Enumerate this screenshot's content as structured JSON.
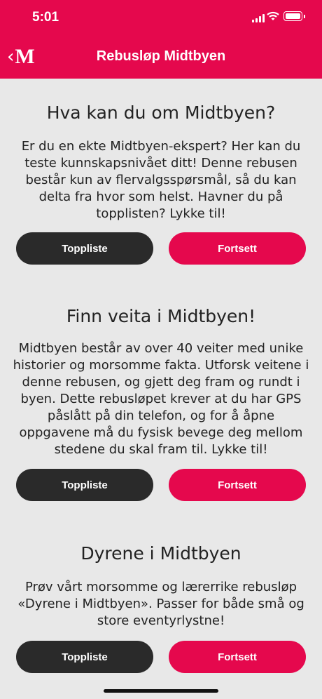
{
  "status_bar": {
    "time": "5:01"
  },
  "nav": {
    "back_logo": "M",
    "title": "Rebusløp Midtbyen"
  },
  "cards": [
    {
      "title": "Hva kan du om Midtbyen?",
      "description": "Er du en ekte Midtbyen-ekspert? Her kan du teste kunnskapsnivået ditt! Denne rebusen består kun av flervalgsspørsmål, så du kan delta fra hvor som helst. Havner du på topplisten? Lykke til!",
      "leaderboard_label": "Toppliste",
      "continue_label": "Fortsett"
    },
    {
      "title": "Finn veita i Midtbyen!",
      "description": "Midtbyen består av over 40 veiter med unike historier og morsomme fakta. Utforsk veitene i denne rebusen, og gjett deg fram og rundt i byen. Dette rebusløpet krever at du har GPS påslått på din telefon, og for å åpne oppgavene må du fysisk bevege deg mellom stedene du skal fram til. Lykke til!",
      "leaderboard_label": "Toppliste",
      "continue_label": "Fortsett"
    },
    {
      "title": "Dyrene i Midtbyen",
      "description": "Prøv vårt morsomme og lærerrike rebusløp «Dyrene i Midtbyen». Passer for både små og store eventyrlystne!",
      "leaderboard_label": "Toppliste",
      "continue_label": "Fortsett"
    }
  ],
  "colors": {
    "accent": "#e5084d",
    "dark_button": "#2a2a2a",
    "background": "#e8e8e8"
  }
}
